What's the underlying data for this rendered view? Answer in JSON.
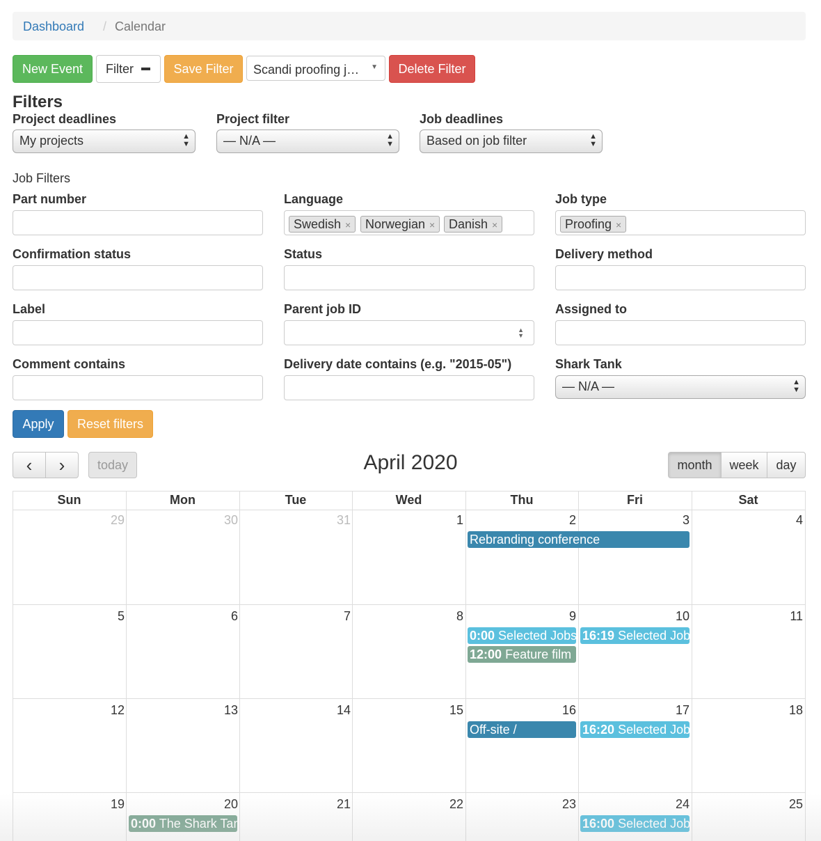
{
  "breadcrumb": {
    "link": "Dashboard",
    "separator": "/",
    "current": "Calendar"
  },
  "toolbar": {
    "new_event": "New Event",
    "filter": "Filter",
    "save_filter": "Save Filter",
    "saved_filter_value": "Scandi proofing j…",
    "delete_filter": "Delete Filter"
  },
  "filters": {
    "heading": "Filters",
    "project_deadlines": {
      "label": "Project deadlines",
      "value": "My projects"
    },
    "project_filter": {
      "label": "Project filter",
      "value": "— N/A —"
    },
    "job_deadlines": {
      "label": "Job deadlines",
      "value": "Based on job filter"
    },
    "job_filters_heading": "Job Filters",
    "part_number": {
      "label": "Part number",
      "value": ""
    },
    "language": {
      "label": "Language",
      "tags": [
        "Swedish",
        "Norwegian",
        "Danish"
      ]
    },
    "job_type": {
      "label": "Job type",
      "tags": [
        "Proofing"
      ]
    },
    "confirmation_status": {
      "label": "Confirmation status",
      "value": ""
    },
    "status": {
      "label": "Status",
      "value": ""
    },
    "delivery_method": {
      "label": "Delivery method",
      "value": ""
    },
    "label": {
      "label": "Label",
      "value": ""
    },
    "parent_job_id": {
      "label": "Parent job ID",
      "value": ""
    },
    "assigned_to": {
      "label": "Assigned to",
      "value": ""
    },
    "comment_contains": {
      "label": "Comment contains",
      "value": ""
    },
    "delivery_date_contains": {
      "label": "Delivery date contains (e.g. \"2015-05\")",
      "value": ""
    },
    "shark_tank": {
      "label": "Shark Tank",
      "value": "— N/A —"
    },
    "apply": "Apply",
    "reset": "Reset filters"
  },
  "calendar": {
    "title": "April 2020",
    "prev": "‹",
    "next": "›",
    "today": "today",
    "views": [
      "month",
      "week",
      "day"
    ],
    "active_view": "month",
    "weekdays": [
      "Sun",
      "Mon",
      "Tue",
      "Wed",
      "Thu",
      "Fri",
      "Sat"
    ],
    "weeks": [
      [
        "29",
        "30",
        "31",
        "1",
        "2",
        "3",
        "4"
      ],
      [
        "5",
        "6",
        "7",
        "8",
        "9",
        "10",
        "11"
      ],
      [
        "12",
        "13",
        "14",
        "15",
        "16",
        "17",
        "18"
      ],
      [
        "19",
        "20",
        "21",
        "22",
        "23",
        "24",
        "25"
      ]
    ],
    "events": {
      "rebranding": {
        "title": "Rebranding conference"
      },
      "apr9_a": {
        "time": "0:00",
        "title": "Selected Jobs"
      },
      "apr9_b": {
        "time": "12:00",
        "title": "Feature film"
      },
      "apr10": {
        "time": "16:19",
        "title": "Selected Jobs"
      },
      "apr16": {
        "title": "Off-site /"
      },
      "apr17": {
        "time": "16:20",
        "title": "Selected Jobs"
      },
      "apr20": {
        "time": "0:00",
        "title": "The Shark Tank"
      },
      "apr24": {
        "time": "16:00",
        "title": "Selected Jobs"
      }
    },
    "colors": {
      "blue_event": "#3a87ad",
      "light_blue_event": "#5bc0de",
      "green_event": "#7fa894"
    }
  }
}
